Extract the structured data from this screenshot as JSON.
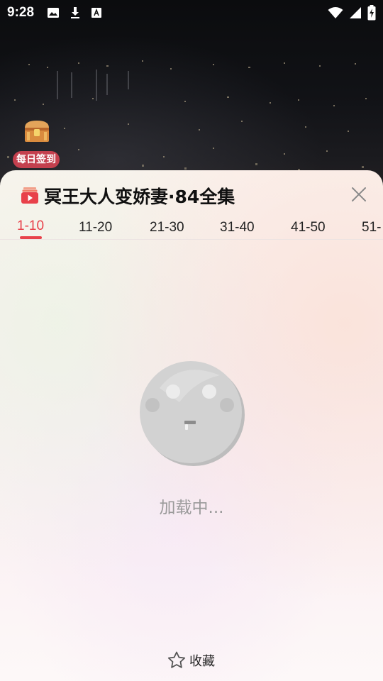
{
  "status_bar": {
    "time": "9:28",
    "left_icons": [
      "image-icon",
      "download-icon",
      "keyboard-a-icon"
    ],
    "right_icons": [
      "wifi-icon",
      "signal-icon",
      "battery-charging-icon"
    ]
  },
  "checkin": {
    "label": "每日签到",
    "icon": "treasure-chest-icon"
  },
  "sheet": {
    "title": "冥王大人变娇妻·84全集",
    "title_icon": "play-stack-icon",
    "close_icon": "close-icon",
    "tabs": [
      {
        "label": "1-10",
        "active": true
      },
      {
        "label": "11-20",
        "active": false
      },
      {
        "label": "21-30",
        "active": false
      },
      {
        "label": "31-40",
        "active": false
      },
      {
        "label": "41-50",
        "active": false
      },
      {
        "label": "51-",
        "active": false
      }
    ],
    "loading_text": "加载中...",
    "favorite_label": "收藏",
    "favorite_icon": "star-outline-icon"
  },
  "colors": {
    "accent": "#e8414a",
    "checkin_bg": "#c4404e",
    "loading_text": "#9a9a9a"
  }
}
